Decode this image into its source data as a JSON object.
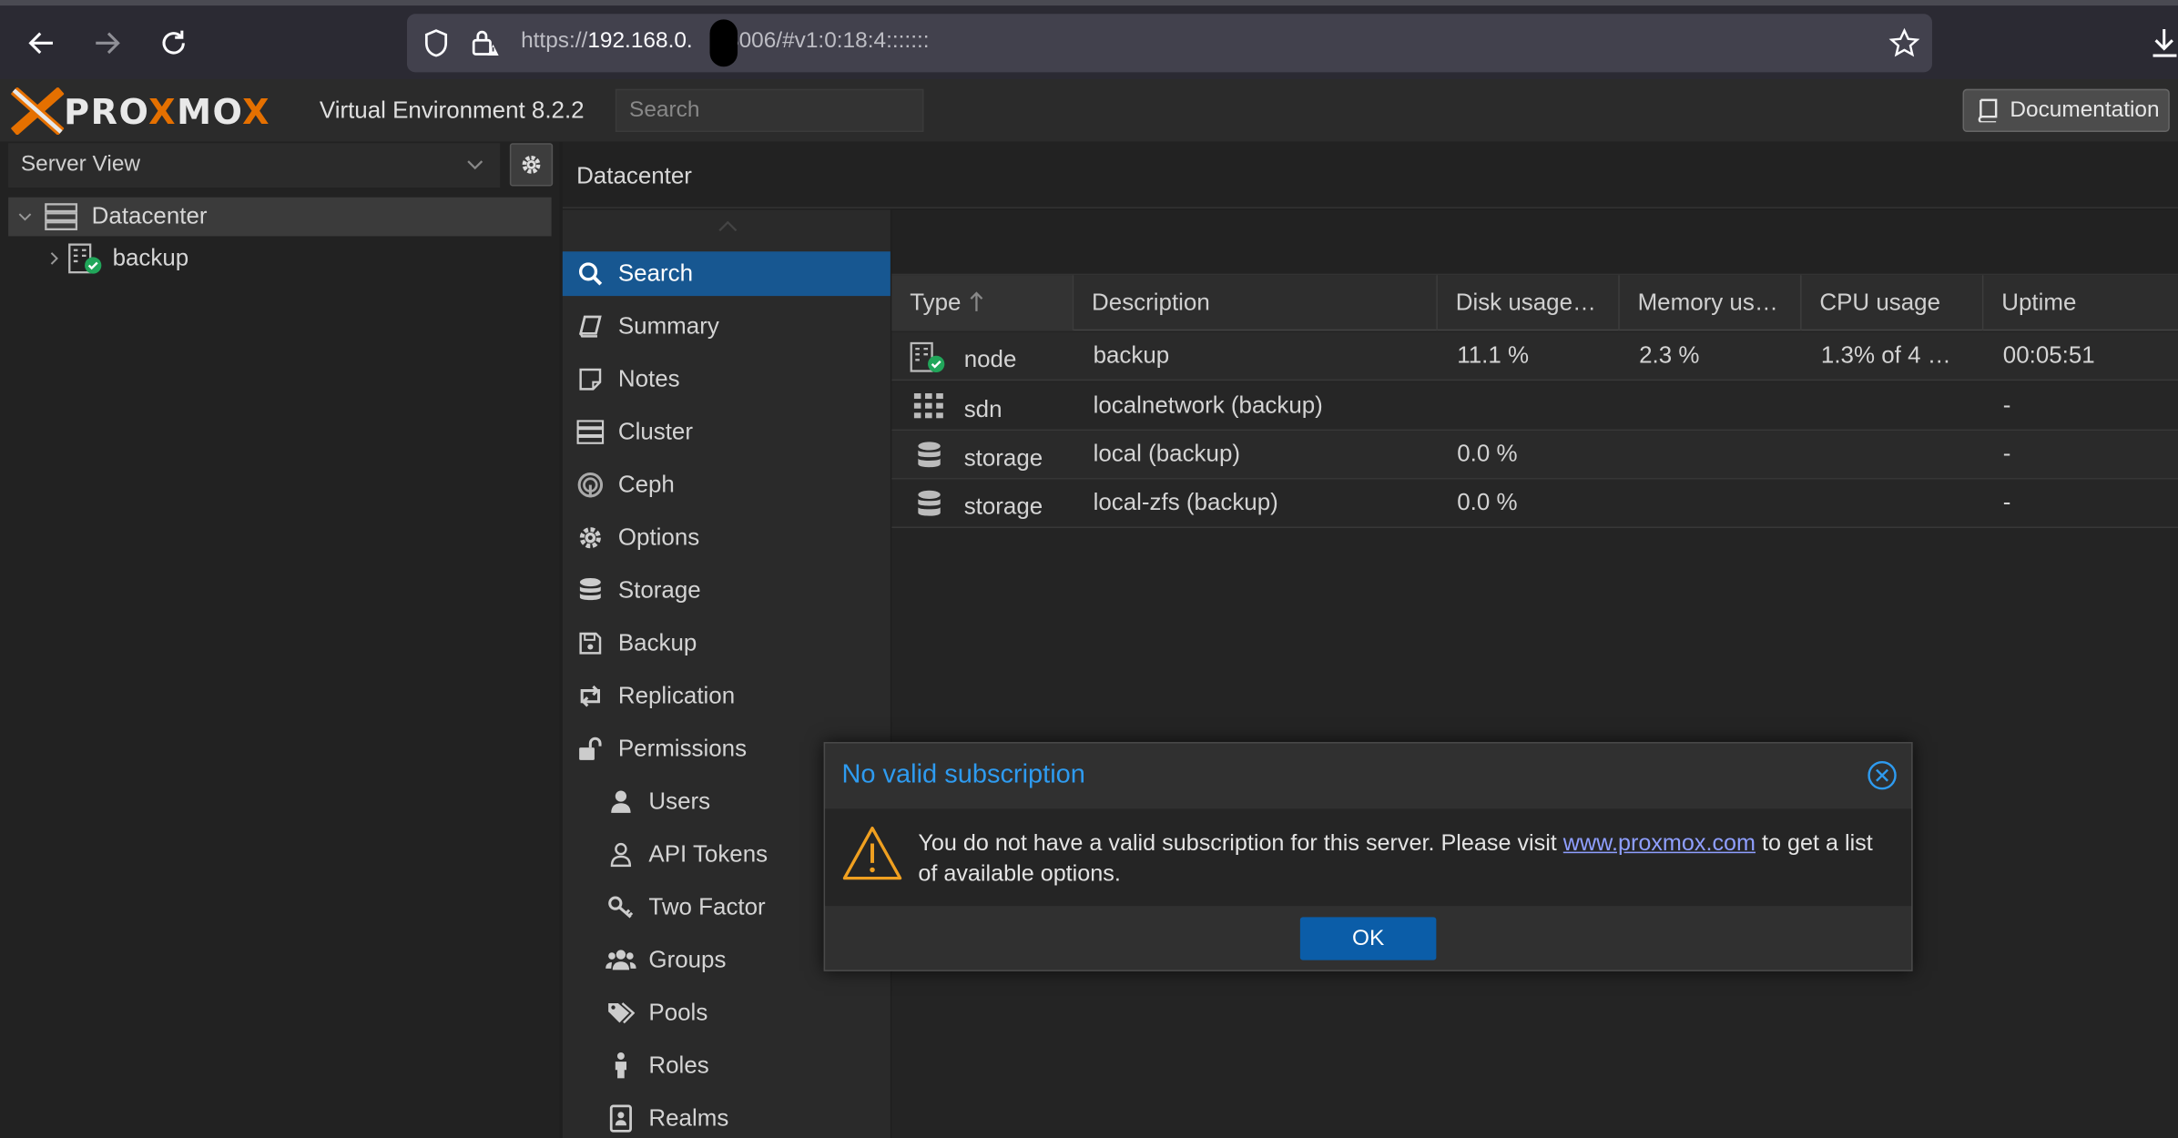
{
  "browser": {
    "url_prefix": "https://",
    "url_host": "192.168.0.",
    "url_rest": ":8006/#v1:0:18:4:::::::"
  },
  "header": {
    "brand_a": "PRO",
    "brand_x": "X",
    "brand_b": "MO",
    "brand_c": "X",
    "version": "Virtual Environment 8.2.2",
    "search_placeholder": "Search",
    "documentation_label": "Documentation"
  },
  "sidebar": {
    "view_label": "Server View",
    "tree": [
      {
        "label": "Datacenter"
      },
      {
        "label": "backup"
      }
    ]
  },
  "main": {
    "title": "Datacenter",
    "menu": [
      {
        "label": "Search"
      },
      {
        "label": "Summary"
      },
      {
        "label": "Notes"
      },
      {
        "label": "Cluster"
      },
      {
        "label": "Ceph"
      },
      {
        "label": "Options"
      },
      {
        "label": "Storage"
      },
      {
        "label": "Backup"
      },
      {
        "label": "Replication"
      },
      {
        "label": "Permissions"
      },
      {
        "label": "Users"
      },
      {
        "label": "API Tokens"
      },
      {
        "label": "Two Factor"
      },
      {
        "label": "Groups"
      },
      {
        "label": "Pools"
      },
      {
        "label": "Roles"
      },
      {
        "label": "Realms"
      }
    ],
    "columns": [
      "Type",
      "Description",
      "Disk usage…",
      "Memory us…",
      "CPU usage",
      "Uptime"
    ],
    "rows": [
      {
        "type": "node",
        "description": "backup",
        "disk": "11.1 %",
        "memory": "2.3 %",
        "cpu": "1.3% of 4 …",
        "uptime": "00:05:51"
      },
      {
        "type": "sdn",
        "description": "localnetwork (backup)",
        "disk": "",
        "memory": "",
        "cpu": "",
        "uptime": "-"
      },
      {
        "type": "storage",
        "description": "local (backup)",
        "disk": "0.0 %",
        "memory": "",
        "cpu": "",
        "uptime": "-"
      },
      {
        "type": "storage",
        "description": "local-zfs (backup)",
        "disk": "0.0 %",
        "memory": "",
        "cpu": "",
        "uptime": "-"
      }
    ]
  },
  "dialog": {
    "title": "No valid subscription",
    "text_before": "You do not have a valid subscription for this server. Please visit ",
    "link": "www.proxmox.com",
    "text_after": " to get a list of available options.",
    "ok_label": "OK"
  },
  "colors": {
    "accent": "#175791",
    "brand_orange": "#e57000",
    "dialog_title": "#2e9bf0"
  }
}
